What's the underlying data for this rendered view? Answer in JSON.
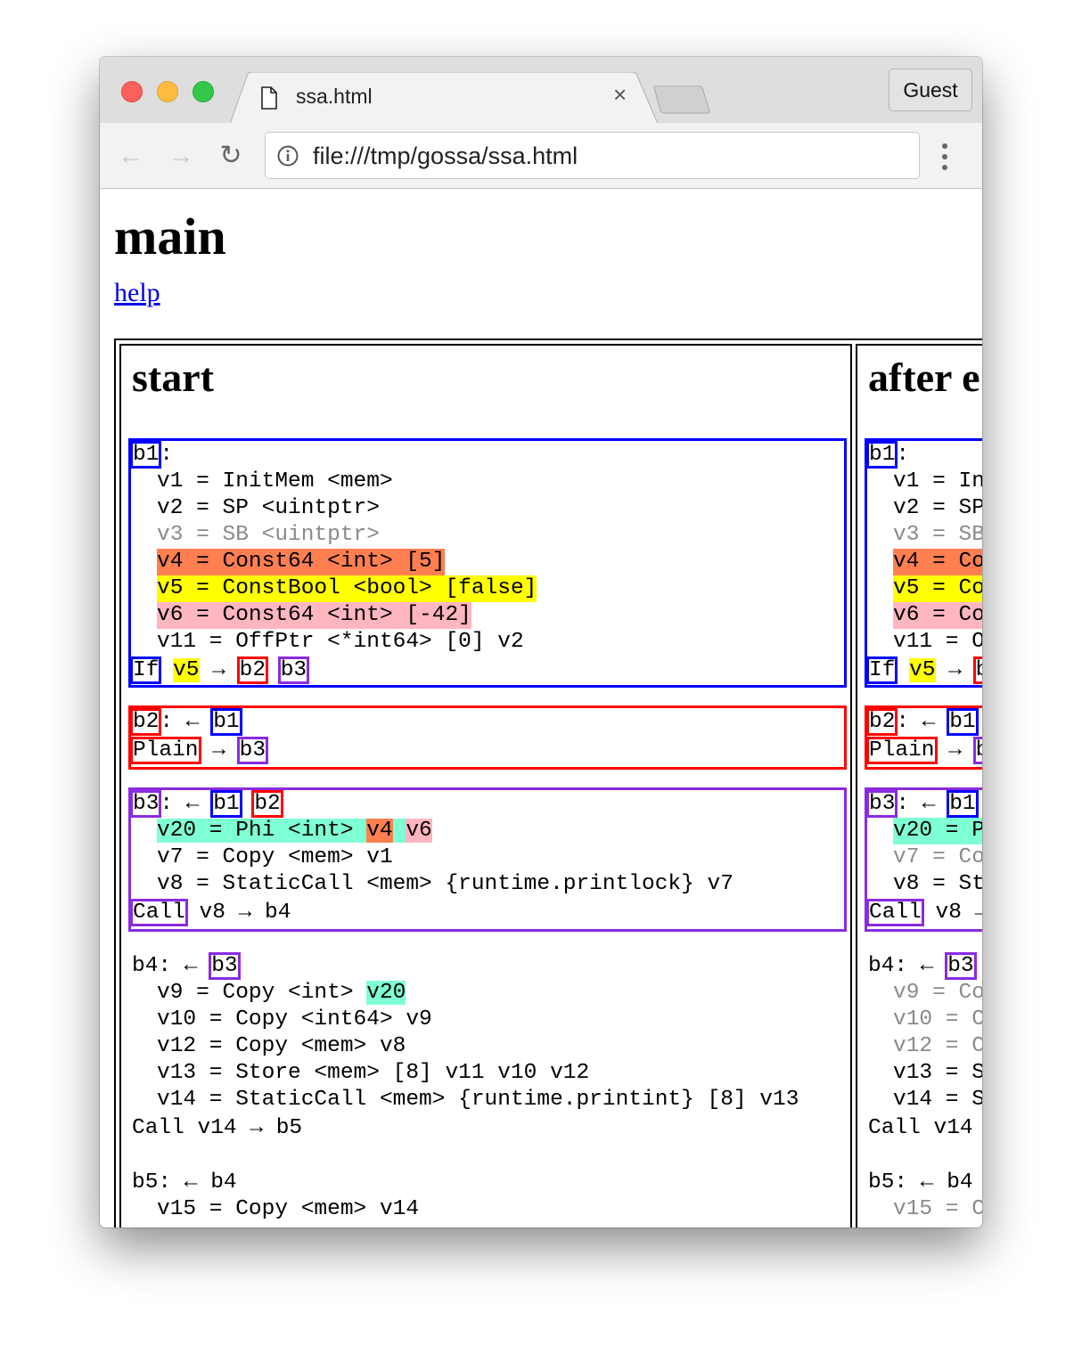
{
  "browser": {
    "tab_title": "ssa.html",
    "tab_close": "×",
    "profile_button": "Guest",
    "url": "file:///tmp/gossa/ssa.html",
    "icons": {
      "back": "arrow-left-icon",
      "forward": "arrow-right-icon",
      "reload": "reload-icon",
      "info": "info-icon",
      "menu": "kebab-menu-icon",
      "page": "document-icon"
    },
    "back_glyph": "←",
    "forward_glyph": "→",
    "reload_glyph": "↻"
  },
  "page": {
    "title": "main",
    "help_link": "help"
  },
  "colors": {
    "b1": "#0000ff",
    "b2": "#ff0000",
    "b3": "#8a2be2",
    "v4": "#ff7f50",
    "v5": "#ffff00",
    "v6": "#ffb6c1",
    "v20": "#7fffd4",
    "dead": "#8a8a8a"
  },
  "passes": [
    {
      "name": "start",
      "blocks": {
        "b1": {
          "label": "b1",
          "header_suffix": ":",
          "values": [
            {
              "id": "v1",
              "text": "v1 = InitMem <mem>"
            },
            {
              "id": "v2",
              "text": "v2 = SP <uintptr>"
            },
            {
              "id": "v3",
              "text": "v3 = SB <uintptr>",
              "dead": true
            },
            {
              "id": "v4",
              "text": "v4 = Const64 <int> [5]"
            },
            {
              "id": "v5",
              "text": "v5 = ConstBool <bool> [false]"
            },
            {
              "id": "v6",
              "text": "v6 = Const64 <int> [-42]"
            },
            {
              "id": "v11",
              "text": "v11 = OffPtr <*int64> [0] v2"
            }
          ],
          "control": {
            "kind": "If",
            "arg": "v5",
            "arrow": "→",
            "succs": [
              "b2",
              "b3"
            ]
          }
        },
        "b2": {
          "label": "b2",
          "header_suffix": ": ←",
          "preds": [
            "b1"
          ],
          "control": {
            "kind": "Plain",
            "arrow": "→",
            "succs": [
              "b3"
            ]
          }
        },
        "b3": {
          "label": "b3",
          "header_suffix": ": ←",
          "preds": [
            "b1",
            "b2"
          ],
          "v20": {
            "prefix": "v20 = Phi <int> ",
            "arg1": "v4",
            "arg2": "v6"
          },
          "values": [
            {
              "id": "v7",
              "text": "v7 = Copy <mem> v1"
            },
            {
              "id": "v8",
              "text": "v8 = StaticCall <mem> {runtime.printlock} v7"
            }
          ],
          "control": {
            "kind": "Call",
            "rest": " v8 → b4"
          }
        },
        "b4": {
          "label": "b4",
          "header_suffix": ": ←",
          "preds": [
            "b3"
          ],
          "v9": {
            "prefix": "v9 = Copy <int> ",
            "arg": "v20"
          },
          "values": [
            {
              "id": "v10",
              "text": "v10 = Copy <int64> v9"
            },
            {
              "id": "v12",
              "text": "v12 = Copy <mem> v8"
            },
            {
              "id": "v13",
              "text": "v13 = Store <mem> [8] v11 v10 v12"
            },
            {
              "id": "v14",
              "text": "v14 = StaticCall <mem> {runtime.printint} [8] v13"
            }
          ],
          "control": "Call v14 → b5"
        },
        "b5": {
          "header": "b5: ← b4",
          "values": [
            {
              "id": "v15",
              "text": "v15 = Copy <mem> v14"
            }
          ]
        }
      }
    },
    {
      "name": "after e",
      "blocks": {
        "b1": {
          "label": "b1",
          "header_suffix": ":",
          "values": [
            {
              "id": "v1",
              "text": "v1 = In"
            },
            {
              "id": "v2",
              "text": "v2 = SP"
            },
            {
              "id": "v3",
              "text": "v3 = SB",
              "dead": true
            },
            {
              "id": "v4",
              "text": "v4 = Co"
            },
            {
              "id": "v5",
              "text": "v5 = Co"
            },
            {
              "id": "v6",
              "text": "v6 = Co"
            },
            {
              "id": "v11",
              "text": "v11 = O"
            }
          ],
          "control": {
            "kind": "If",
            "arg": "v5",
            "arrow": "→"
          }
        },
        "b2": {
          "label": "b2",
          "header_suffix": ": ←",
          "pred": "b1",
          "control": "Plain",
          "arrow": "→"
        },
        "b3": {
          "label": "b3",
          "header_suffix": ": ←",
          "pred": "b1",
          "values": [
            {
              "id": "v20",
              "text": "v20 = P"
            },
            {
              "id": "v7",
              "text": "v7 = Co",
              "dead": true
            },
            {
              "id": "v8",
              "text": "v8 = St"
            }
          ],
          "control": "Call",
          "control_rest": " v8 →"
        },
        "b4": {
          "header": "b4: ←",
          "pred": "b3",
          "values": [
            {
              "id": "v9",
              "text": "v9 = Co",
              "dead": true
            },
            {
              "id": "v10",
              "text": "v10 = C",
              "dead": true
            },
            {
              "id": "v12",
              "text": "v12 = C",
              "dead": true
            },
            {
              "id": "v13",
              "text": "v13 = S"
            },
            {
              "id": "v14",
              "text": "v14 = S"
            }
          ],
          "control": "Call v14"
        },
        "b5": {
          "header": "b5: ← b4",
          "values": [
            {
              "id": "v15",
              "text": "v15 = C",
              "dead": true
            }
          ]
        }
      }
    }
  ]
}
